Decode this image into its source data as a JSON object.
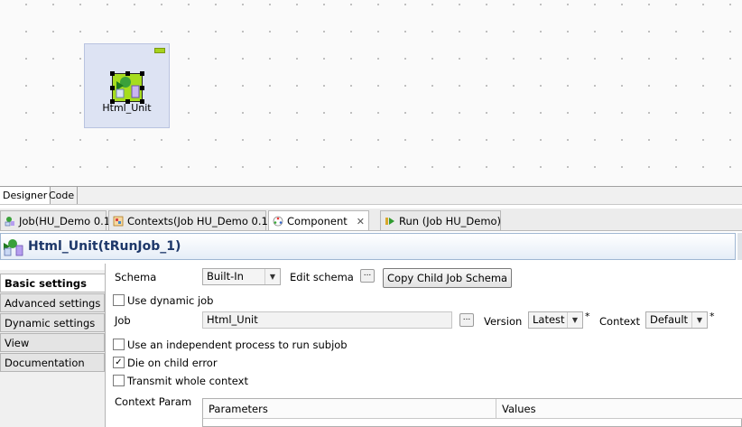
{
  "canvas": {
    "node_label": "Html_Unit"
  },
  "view_tabs": [
    {
      "label": "Designer",
      "active": true
    },
    {
      "label": "Code",
      "active": false
    }
  ],
  "editor_tabs": [
    {
      "label": "Job(HU_Demo 0.1)",
      "icon": "job-icon",
      "active": false
    },
    {
      "label": "Contexts(Job HU_Demo 0.1)",
      "icon": "contexts-icon",
      "active": false
    },
    {
      "label": "Component",
      "icon": "component-icon",
      "active": true,
      "close": "✕"
    },
    {
      "label": "Run (Job HU_Demo)",
      "icon": "run-icon",
      "active": false
    }
  ],
  "component_title": "Html_Unit(tRunJob_1)",
  "side_tabs": [
    {
      "label": "Basic settings",
      "active": true
    },
    {
      "label": "Advanced settings"
    },
    {
      "label": "Dynamic settings"
    },
    {
      "label": "View"
    },
    {
      "label": "Documentation"
    }
  ],
  "settings": {
    "schema_label": "Schema",
    "schema_value": "Built-In",
    "edit_schema_label": "Edit schema",
    "dots": "...",
    "copy_schema_button": "Copy Child Job Schema",
    "use_dynamic_job": "Use dynamic job",
    "job_label": "Job",
    "job_value": "Html_Unit",
    "version_label": "Version",
    "version_value": "Latest",
    "context_label": "Context",
    "context_value": "Default",
    "required_mark": "*",
    "independent_process": "Use an independent process to run subjob",
    "die_on_error": "Die on child error",
    "die_on_error_checked": true,
    "transmit_context": "Transmit whole context",
    "context_param_label": "Context Param",
    "table_headers": [
      "Parameters",
      "Values"
    ]
  }
}
